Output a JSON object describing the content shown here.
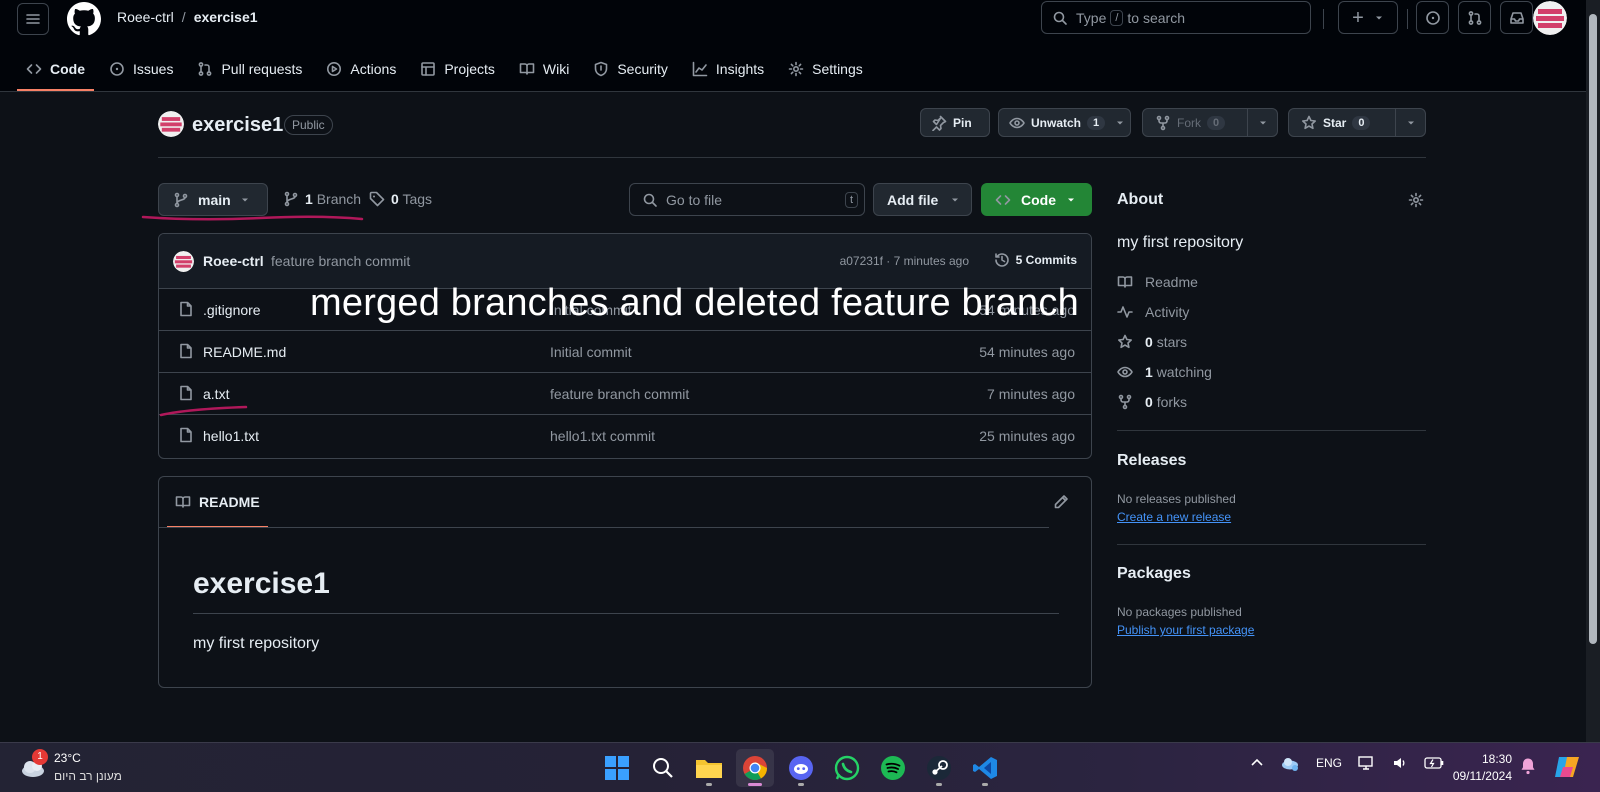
{
  "header": {
    "owner": "Roee-ctrl",
    "separator": "/",
    "repo": "exercise1",
    "search_prefix": "Type",
    "search_key": "/",
    "search_suffix": "to search",
    "create_label": "+"
  },
  "nav": {
    "tabs": [
      {
        "label": "Code"
      },
      {
        "label": "Issues"
      },
      {
        "label": "Pull requests"
      },
      {
        "label": "Actions"
      },
      {
        "label": "Projects"
      },
      {
        "label": "Wiki"
      },
      {
        "label": "Security"
      },
      {
        "label": "Insights"
      },
      {
        "label": "Settings"
      }
    ]
  },
  "repo": {
    "title": "exercise1",
    "visibility": "Public",
    "pin_label": "Pin",
    "unwatch_label": "Unwatch",
    "watch_count": "1",
    "fork_label": "Fork",
    "fork_count": "0",
    "star_label": "Star",
    "star_count": "0"
  },
  "toolbar": {
    "branch": "main",
    "branches_count": "1",
    "branches_label": "Branch",
    "tags_count": "0",
    "tags_label": "Tags",
    "goto_placeholder": "Go to file",
    "goto_key": "t",
    "add_file_label": "Add file",
    "code_label": "Code"
  },
  "commit": {
    "author": "Roee-ctrl",
    "message": "feature branch commit",
    "meta": "a07231f · 7 minutes ago",
    "commits_label": "5 Commits"
  },
  "files": [
    {
      "name": ".gitignore",
      "message": "Initial commit",
      "time": "54 minutes ago"
    },
    {
      "name": "README.md",
      "message": "Initial commit",
      "time": "54 minutes ago"
    },
    {
      "name": "a.txt",
      "message": "feature branch commit",
      "time": "7 minutes ago"
    },
    {
      "name": "hello1.txt",
      "message": "hello1.txt commit",
      "time": "25 minutes ago"
    }
  ],
  "readme": {
    "tab_label": "README",
    "heading": "exercise1",
    "body": "my first repository"
  },
  "sidebar": {
    "about_title": "About",
    "description": "my first repository",
    "items": [
      {
        "icon": "book-icon",
        "bold": "",
        "text": "Readme"
      },
      {
        "icon": "pulse-icon",
        "bold": "",
        "text": "Activity"
      },
      {
        "icon": "star-icon",
        "bold": "0",
        "text": "stars"
      },
      {
        "icon": "eye-icon",
        "bold": "1",
        "text": "watching"
      },
      {
        "icon": "fork-icon",
        "bold": "0",
        "text": "forks"
      }
    ],
    "releases_title": "Releases",
    "releases_empty": "No releases published",
    "releases_link": "Create a new release",
    "packages_title": "Packages",
    "packages_empty": "No packages published",
    "packages_link": "Publish your first package"
  },
  "overlay": {
    "caption": "merged branches and deleted feature branch"
  },
  "taskbar": {
    "weather_badge": "1",
    "temperature": "23°C",
    "weather_desc": "מעונן רב היום",
    "language": "ENG",
    "time": "18:30",
    "date": "09/11/2024"
  },
  "colors": {
    "background": "#0d1117",
    "accent_tab": "#f78166",
    "code_button": "#238636",
    "link": "#4493f8",
    "annotation": "#b0185a"
  }
}
